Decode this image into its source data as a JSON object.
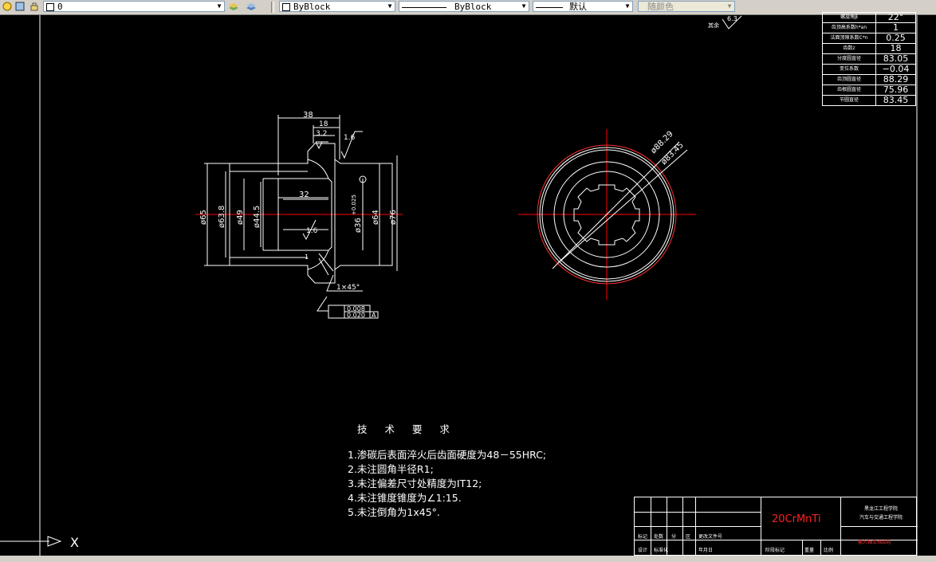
{
  "toolbar": {
    "layer_value": "0",
    "color_value": "ByBlock",
    "linetype_value": "ByBlock",
    "lineweight_value": "默认",
    "plotstyle_value": "随颜色"
  },
  "drawing": {
    "left_view_dims": {
      "d38": "38",
      "d18": "18",
      "d3_2": "3.2",
      "d1_6a": "1.6",
      "d32": "32",
      "d1_6b": "1.6",
      "d65": "ø65",
      "d63_8": "ø63.8",
      "d49": "ø49",
      "d44_5": "ø44.5",
      "d36": "ø36",
      "tol": "+0.025",
      "d64": "ø64",
      "d76": "ø76",
      "d1": "1",
      "chamfer": "1×45°",
      "gtol1": "0.008",
      "gtol2": "0.020",
      "datum": "A"
    },
    "right_view_dims": {
      "d88_29": "ø88.29",
      "d83_45": "ø83.45"
    },
    "roughness_other": "其余",
    "roughness_value": "6.3"
  },
  "tech_requirements": {
    "title": "技 术 要 求",
    "lines": [
      "1.渗碳后表面淬火后齿面硬度为48－55HRC;",
      "2.未注圆角半径R1;",
      "3.未注偏差尺寸处精度为IT12;",
      "4.未注锥度锥度为∠1:15.",
      "5.未注倒角为1x45°."
    ]
  },
  "params_table": [
    {
      "label": "螺旋角β",
      "value": "22°"
    },
    {
      "label": "齿顶高系数h*an",
      "value": "1"
    },
    {
      "label": "法面顶隙系数C*n",
      "value": "0.25"
    },
    {
      "label": "齿数z",
      "value": "18"
    },
    {
      "label": "分度圆直径",
      "value": "83.05"
    },
    {
      "label": "变位系数",
      "value": "−0.04"
    },
    {
      "label": "齿顶圆直径",
      "value": "88.29"
    },
    {
      "label": "齿根圆直径",
      "value": "75.96"
    },
    {
      "label": "节圆直径",
      "value": "83.45"
    }
  ],
  "title_block": {
    "material": "20CrMnTi",
    "school": "黑龙江工程学院",
    "dept": "汽车与交通工程学院",
    "part_name": "输入轴五挡齿轮",
    "row1": [
      "标记",
      "处数",
      "分",
      "区",
      "更改文件号"
    ],
    "row2": [
      "设计",
      "标准化",
      "",
      "",
      "年月日"
    ],
    "stage": "阶段标记",
    "weight": "重量",
    "scale": "比例"
  },
  "colors": {
    "background": "#000000",
    "line": "#ffffff",
    "center_line": "#ff0000",
    "material_text": "#ff2020"
  },
  "status": {
    "x_marker": "X"
  }
}
